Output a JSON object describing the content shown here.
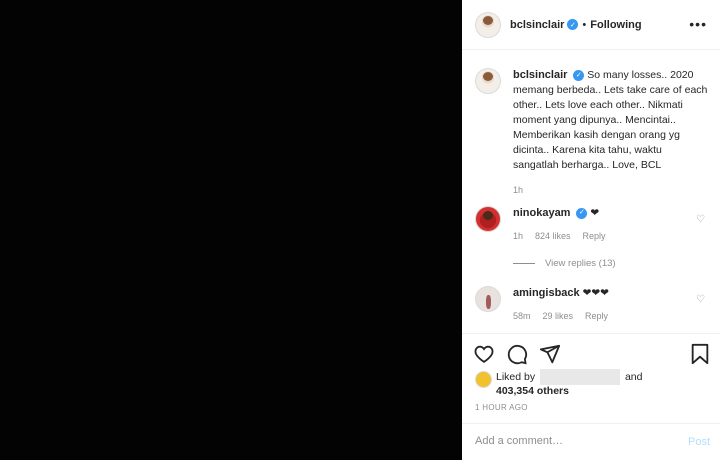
{
  "post": {
    "username": "bclsinclair",
    "follow_status": "Following",
    "more_label": "•••",
    "caption": "So many losses.. 2020 memang berbeda.. Lets take care of each other.. Lets love each other.. Nikmati moment yang dipunya.. Mencintai.. Memberikan kasih dengan orang yg dicinta.. Karena kita tahu, waktu sangatlah berharga.. Love, BCL",
    "caption_time": "1h"
  },
  "comments": [
    {
      "username": "ninokayam",
      "text": "❤",
      "time": "1h",
      "likes": "824 likes",
      "reply": "Reply",
      "view_replies": "View replies (13)"
    },
    {
      "username": "amingisback",
      "text": "❤❤❤",
      "time": "58m",
      "likes": "29 likes",
      "reply": "Reply"
    }
  ],
  "likes": {
    "prefix": "Liked by",
    "and": "and",
    "others": "403,354 others"
  },
  "posted_time": "1 HOUR AGO",
  "add_comment": {
    "placeholder": "Add a comment…",
    "post_label": "Post"
  },
  "colors": {
    "verified": "#3897f0",
    "post_disabled": "#b2dffc",
    "secondary_text": "#8e8e8e"
  }
}
